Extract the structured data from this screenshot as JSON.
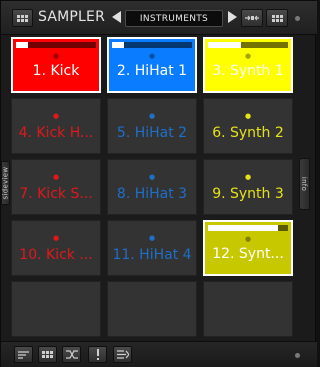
{
  "header": {
    "title": "SAMPLER",
    "bank_label": "INSTRUMENTS"
  },
  "side_tabs": {
    "left": "sidеview",
    "right": "info"
  },
  "pads": [
    {
      "label": "1. Kick",
      "color": "#ff0000",
      "state": "loaded",
      "level": 0.15
    },
    {
      "label": "2. HiHat 1",
      "color": "#0a7cff",
      "state": "loaded",
      "level": 0.15
    },
    {
      "label": "3. Synth 1",
      "color": "#ffff00",
      "state": "loaded",
      "level": 0.4
    },
    {
      "label": "4. Kick H...",
      "color": "#e0181b",
      "state": "idle"
    },
    {
      "label": "5. HiHat 2",
      "color": "#1e6fc8",
      "state": "idle"
    },
    {
      "label": "6. Synth 2",
      "color": "#e6e21a",
      "state": "idle"
    },
    {
      "label": "7. Kick S...",
      "color": "#e0181b",
      "state": "idle"
    },
    {
      "label": "8. HiHat 3",
      "color": "#1e6fc8",
      "state": "idle"
    },
    {
      "label": "9. Synth 3",
      "color": "#e6e21a",
      "state": "idle"
    },
    {
      "label": "10. Kick ...",
      "color": "#e0181b",
      "state": "idle"
    },
    {
      "label": "11. HiHat 4",
      "color": "#1e6fc8",
      "state": "idle"
    },
    {
      "label": "12. Synt...",
      "color": "#c8c800",
      "state": "loaded",
      "level": 0.85
    },
    {
      "label": "",
      "state": "empty"
    },
    {
      "label": "",
      "state": "empty"
    },
    {
      "label": "",
      "state": "empty"
    }
  ],
  "footer_icons": [
    "pad-settings-icon",
    "grid-view-icon",
    "shuffle-icon",
    "level-icon",
    "list-icon"
  ]
}
